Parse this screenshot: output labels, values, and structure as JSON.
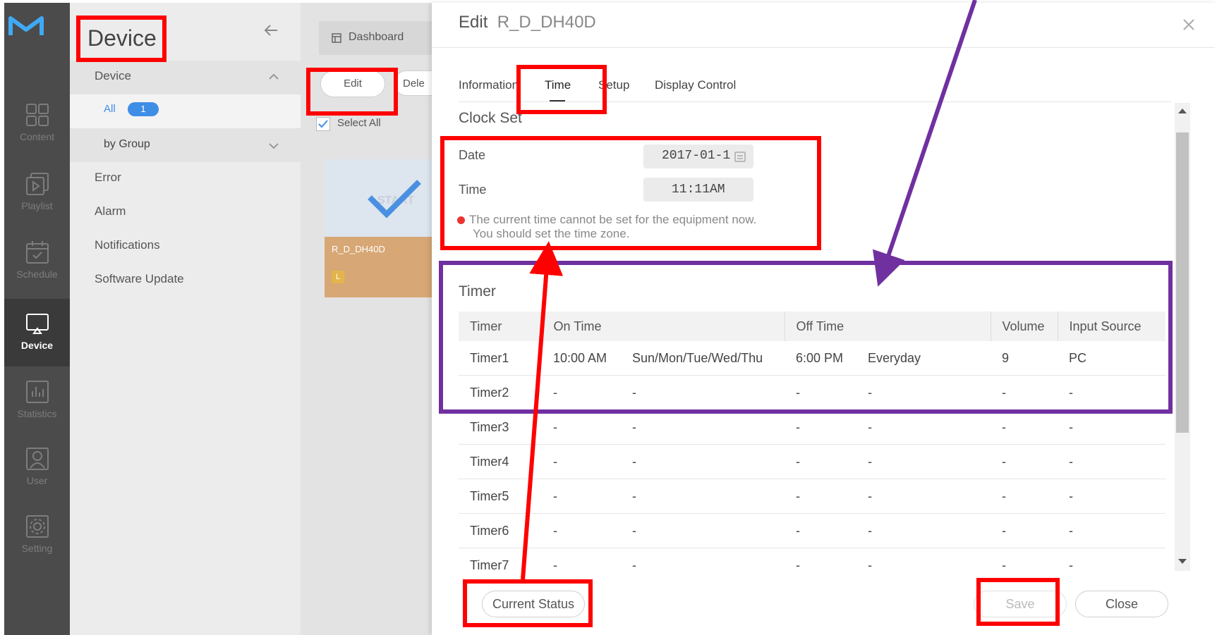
{
  "rail": {
    "items": [
      {
        "label": "Content",
        "icon": "content-icon"
      },
      {
        "label": "Playlist",
        "icon": "playlist-icon"
      },
      {
        "label": "Schedule",
        "icon": "schedule-icon"
      },
      {
        "label": "Device",
        "icon": "device-icon",
        "active": true
      },
      {
        "label": "Statistics",
        "icon": "statistics-icon"
      },
      {
        "label": "User",
        "icon": "user-icon"
      },
      {
        "label": "Setting",
        "icon": "setting-icon"
      }
    ]
  },
  "nav": {
    "title": "Device",
    "section_device": "Device",
    "all_label": "All",
    "all_count": "1",
    "by_group": "by Group",
    "error": "Error",
    "alarm": "Alarm",
    "notifications": "Notifications",
    "software_update": "Software Update"
  },
  "devarea": {
    "dashboard": "Dashboard",
    "edit": "Edit",
    "delete_partial": "Dele",
    "select_all": "Select All",
    "card_name": "R_D_DH40D",
    "card_badge": "L",
    "card_overlay": "START"
  },
  "modal": {
    "title_prefix": "Edit",
    "title_device": "R_D_DH40D",
    "tabs": [
      "Information",
      "Time",
      "Setup",
      "Display Control"
    ],
    "active_tab": "Time",
    "clock_set": {
      "heading": "Clock Set",
      "date_label": "Date",
      "date_value": "2017-01-1",
      "time_label": "Time",
      "time_value": "11:11AM",
      "warning_line1": "The current time cannot be set for the equipment now.",
      "warning_line2": "You should set the time zone."
    },
    "timer": {
      "heading": "Timer",
      "columns": [
        "Timer",
        "On Time",
        "Off Time",
        "Volume",
        "Input Source"
      ],
      "rows": [
        [
          "Timer1",
          "10:00 AM",
          "Sun/Mon/Tue/Wed/Thu",
          "6:00 PM",
          "Everyday",
          "9",
          "PC"
        ],
        [
          "Timer2",
          "-",
          "-",
          "-",
          "-",
          "-",
          "-"
        ],
        [
          "Timer3",
          "-",
          "-",
          "-",
          "-",
          "-",
          "-"
        ],
        [
          "Timer4",
          "-",
          "-",
          "-",
          "-",
          "-",
          "-"
        ],
        [
          "Timer5",
          "-",
          "-",
          "-",
          "-",
          "-",
          "-"
        ],
        [
          "Timer6",
          "-",
          "-",
          "-",
          "-",
          "-",
          "-"
        ],
        [
          "Timer7",
          "-",
          "-",
          "-",
          "-",
          "-",
          "-"
        ]
      ]
    },
    "buttons": {
      "current_status": "Current Status",
      "save": "Save",
      "close": "Close"
    }
  },
  "annotations": {
    "highlight_color": "#ff0000",
    "timer_highlight_color": "#7030a0"
  }
}
